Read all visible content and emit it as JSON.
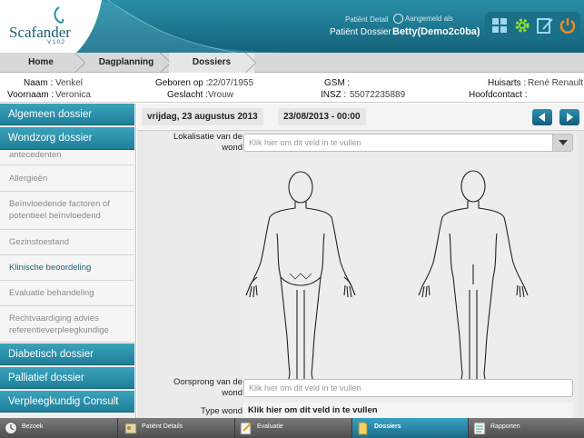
{
  "app": {
    "name": "Scafander",
    "version": "V 1.0.2"
  },
  "header": {
    "patient_detail_small": "Patiënt Detail",
    "patient_dossier": "Patiënt Dossier",
    "aangemeld_small": "Aangemeld als",
    "patient_name": "Betty(Demo2c0ba)",
    "tool_icons": [
      "dashboard-icon",
      "settings-gear-icon",
      "edit-icon",
      "power-icon"
    ]
  },
  "breadcrumb": [
    "Home",
    "Dagplanning",
    "Dossiers"
  ],
  "patient": {
    "naam_label": "Naam :",
    "naam": "Venkel",
    "voornaam_label": "Voornaam :",
    "voornaam": "Veronica",
    "geboren_label": "Geboren op :",
    "geboren": "22/07/1955",
    "geslacht_label": "Geslacht :",
    "geslacht": "Vrouw",
    "gsm_label": "GSM :",
    "gsm": "",
    "insz_label": "INSZ :",
    "insz": "55072235889",
    "huisarts_label": "Huisarts :",
    "huisarts": "René Renault",
    "hoofdcontact_label": "Hoofdcontact :",
    "hoofdcontact": ""
  },
  "sidebar": {
    "section_algemeen": "Algemeen dossier",
    "section_wondzorg": "Wondzorg dossier",
    "items": [
      "antecedenten",
      "Allergieën",
      "Beïnvloedende factoren of potentieel beïnvloedend",
      "Gezinstoestand",
      "Klinische beoordeling",
      "Evaluatie behandeling",
      "Rechtvaardiging advies referentieverpleegkundige"
    ],
    "section_diabetisch": "Diabetisch dossier",
    "section_palliatief": "Palliatief dossier",
    "section_consult": "Verpleegkundig Consult"
  },
  "main": {
    "date_long": "vrijdag, 23 augustus 2013",
    "date_short": "23/08/2013 - 00:00",
    "lokalisatie_label": "Lokalisatie van de wond",
    "lokalisatie_placeholder": "Klik hier om dit veld in te vullen",
    "oorsprong_label": "Oorsprong van de wond",
    "oorsprong_placeholder": "Klik hier om dit veld in te vullen",
    "type_label": "Type wond",
    "type_value": "Klik hier om dit veld in te vullen"
  },
  "bottom_tabs": [
    {
      "label": "Bezoek",
      "icon": "clock-icon",
      "active": false
    },
    {
      "label": "Patiënt Details",
      "icon": "patient-details-icon",
      "active": false
    },
    {
      "label": "Evaluatie",
      "icon": "evaluation-icon",
      "active": false
    },
    {
      "label": "Dossiers",
      "icon": "folder-icon",
      "active": true
    },
    {
      "label": "Rapporten",
      "icon": "reports-icon",
      "active": false
    }
  ],
  "colors": {
    "accent": "#1f7f99",
    "header_dark": "#13627a",
    "active_tab": "#2a8eb0"
  }
}
